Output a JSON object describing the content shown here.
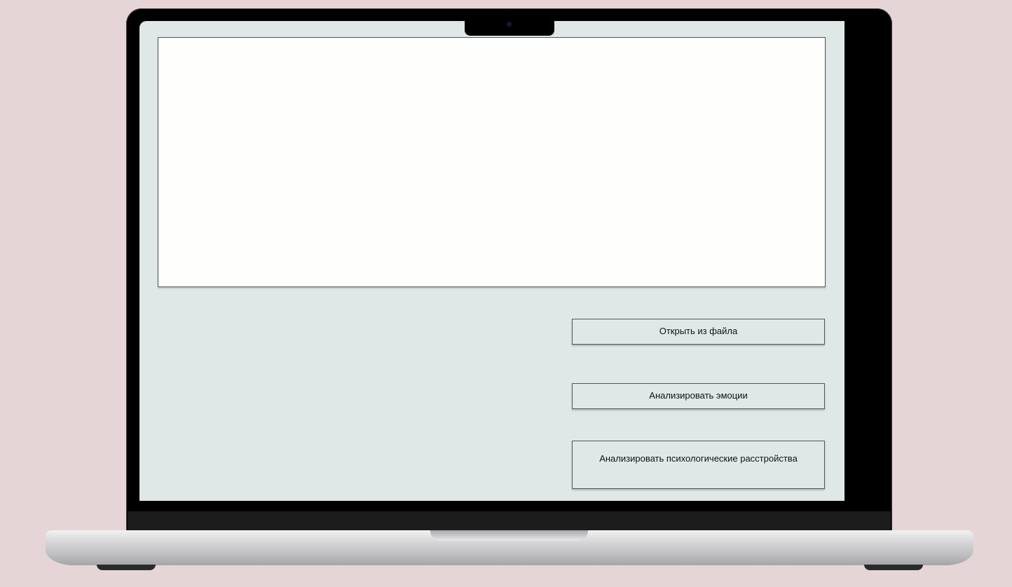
{
  "app": {
    "buttons": {
      "open_file": "Открыть из файла",
      "analyze_emotions": "Анализировать эмоции",
      "analyze_disorders": "Анализировать психологические расстройства"
    },
    "text_area": {
      "value": ""
    }
  },
  "colors": {
    "background": "#e6d5d7",
    "screen": "#dfe8e6",
    "text_area": "#fefefd",
    "bezel": "#000000"
  },
  "device": {
    "type": "laptop-mockup"
  }
}
